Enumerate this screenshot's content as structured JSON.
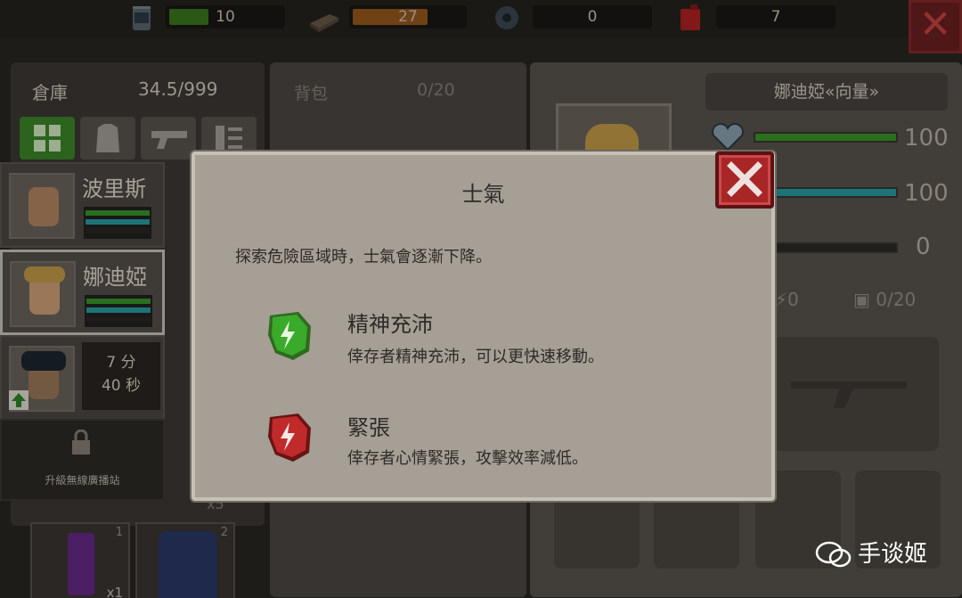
{
  "topbar": {
    "resources": [
      {
        "icon": "canned-food-icon",
        "value": "10",
        "fill_color": "#3b7a1e",
        "fill_fraction": 0.35
      },
      {
        "icon": "wood-icon",
        "value": "27",
        "fill_color": "#9a5a1c",
        "fill_fraction": 0.6
      },
      {
        "icon": "gear-part-icon",
        "value": "0",
        "fill_color": "#333333",
        "fill_fraction": 0
      },
      {
        "icon": "fuel-can-icon",
        "value": "7",
        "fill_color": "#333333",
        "fill_fraction": 0
      }
    ],
    "close_label": "✕"
  },
  "storage": {
    "label": "倉庫",
    "value": "34.5/999",
    "categories": [
      "grid-icon",
      "armor-icon",
      "gun-icon",
      "list-icon"
    ]
  },
  "survivors": [
    {
      "name": "波里斯",
      "selected": false
    },
    {
      "name": "娜迪婭",
      "selected": true
    },
    {
      "name": "",
      "timer_line1": "7 分",
      "timer_line2": "40 秒"
    }
  ],
  "upgrade": {
    "label": "升級無線廣播站"
  },
  "bag": {
    "label": "背包",
    "count": "0/20"
  },
  "character": {
    "name": "娜迪婭«向量»",
    "stats": [
      {
        "icon": "heart-icon",
        "value": "100",
        "color": "#3a9a2a",
        "fraction": 1
      },
      {
        "icon": "water-icon",
        "value": "100",
        "color": "#2aa0a6",
        "fraction": 1
      },
      {
        "icon": "morale-icon",
        "value": "0",
        "color": "#555555",
        "fraction": 0
      }
    ],
    "small_stat_1": "0",
    "small_stat_2": "0/20"
  },
  "items": [
    {
      "qty": "1",
      "sub": "x1"
    },
    {
      "qty": "2",
      "sub": ""
    }
  ],
  "x5": "x5",
  "dialog": {
    "title": "士氣",
    "description": "探索危險區域時，士氣會逐漸下降。",
    "states": [
      {
        "name": "精神充沛",
        "desc": "倖存者精神充沛，可以更快速移動。",
        "icon": "energetic-icon",
        "color": "#3aaa2a"
      },
      {
        "name": "緊張",
        "desc": "倖存者心情緊張，攻擊效率減低。",
        "icon": "nervous-icon",
        "color": "#c02a2a"
      }
    ],
    "close_label": "✕"
  },
  "watermark": {
    "text": "手谈姬"
  }
}
